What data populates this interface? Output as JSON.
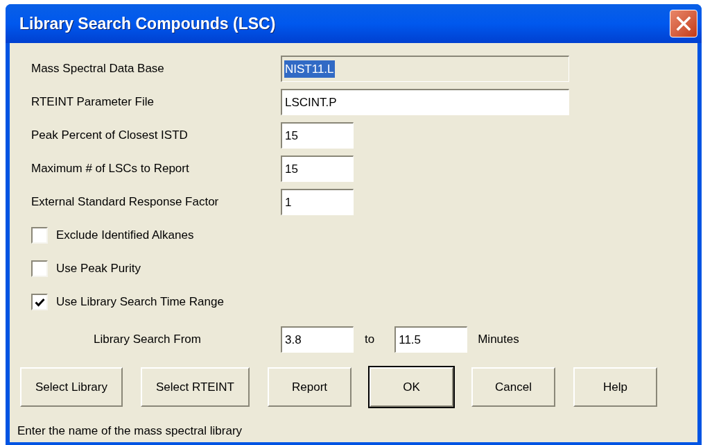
{
  "window": {
    "title": "Library Search Compounds (LSC)"
  },
  "fields": [
    {
      "label": "Mass Spectral Data Base",
      "value": "NIST11.L",
      "read_only": true,
      "selected": true,
      "kind": "wide"
    },
    {
      "label": "RTEINT Parameter File",
      "value": "LSCINT.P",
      "read_only": false,
      "selected": false,
      "kind": "wide"
    },
    {
      "label": "Peak Percent of Closest ISTD",
      "value": "15",
      "read_only": false,
      "selected": false,
      "kind": "short"
    },
    {
      "label": "Maximum # of LSCs to Report",
      "value": "15",
      "read_only": false,
      "selected": false,
      "kind": "short"
    },
    {
      "label": "External Standard Response Factor",
      "value": "1",
      "read_only": false,
      "selected": false,
      "kind": "short"
    }
  ],
  "checkboxes": [
    {
      "label": "Exclude Identified Alkanes",
      "checked": false
    },
    {
      "label": "Use Peak Purity",
      "checked": false
    },
    {
      "label": "Use Library Search Time Range",
      "checked": true
    }
  ],
  "time_range": {
    "label": "Library Search From",
    "from": "3.8",
    "separator": "to",
    "to": "11.5",
    "unit": "Minutes"
  },
  "buttons": [
    {
      "label": "Select Library",
      "default": false
    },
    {
      "label": "Select RTEINT",
      "default": false
    },
    {
      "label": "Report",
      "default": false
    },
    {
      "label": "OK",
      "default": true
    },
    {
      "label": "Cancel",
      "default": false
    },
    {
      "label": "Help",
      "default": false
    }
  ],
  "status_bar": {
    "text": "Enter the name of the mass spectral library"
  }
}
